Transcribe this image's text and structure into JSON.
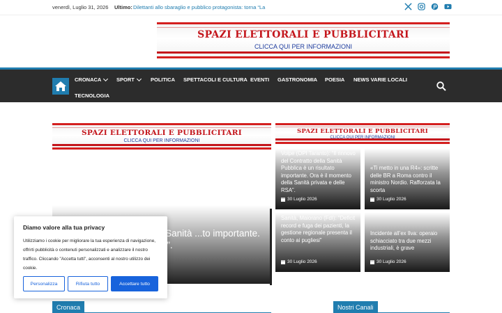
{
  "topbar": {
    "date": "venerdì, Luglio 31, 2026",
    "latest_label": "Ultimo:",
    "latest_text": "Dilettanti allo sbaraglio e pubblico protagonista: torna “La",
    "socials": [
      "x-icon",
      "instagram-icon",
      "pinterest-icon",
      "youtube-icon"
    ]
  },
  "ads": {
    "title": "SPAZI ELETTORALI E PUBBLICITARI",
    "subtitle": "CLICCA QUI PER INFORMAZIONI"
  },
  "nav": {
    "items": [
      {
        "label": "CRONACA",
        "dropdown": true
      },
      {
        "label": "SPORT",
        "dropdown": true
      },
      {
        "label": "POLITICA",
        "dropdown": false
      },
      {
        "label": "SPETTACOLI E CULTURA",
        "dropdown": false
      },
      {
        "label": "EVENTI",
        "dropdown": false
      },
      {
        "label": "GASTRONOMIA",
        "dropdown": false
      },
      {
        "label": "POESIA",
        "dropdown": false
      },
      {
        "label": "NEWS VARIE LOCALI",
        "dropdown": false
      },
      {
        "label": "TECNOLOGIA",
        "dropdown": false
      }
    ]
  },
  "featured": {
    "title": "...ovo del Contratto della Sanità ...to importante. Ora è il ...ata e delle RSA”."
  },
  "cards": [
    {
      "title": "Volpe (OPI Taranto): “Il rinnovo del Contratto della Sanità Pubblica è un risultato importante. Ora è il momento della Sanità privata e delle RSA”.",
      "date": "30 Luglio 2026"
    },
    {
      "title": "«Ti metto in una R4»: scritte delle BR a Roma contro il ministro Nordio. Rafforzata la scorta",
      "date": "30 Luglio 2026"
    },
    {
      "title": "Sanità, Maiorano (FdI): “Deficit record e fuga dei pazienti, la gestione regionale presenta il conto ai pugliesi”",
      "date": "30 Luglio 2026"
    },
    {
      "title": "Incidente all’ex Ilva: operaio schiacciato tra due mezzi industriali, è grave",
      "date": "30 Luglio 2026"
    }
  ],
  "cookie": {
    "title": "Diamo valore alla tua privacy",
    "text": "Utilizziamo i cookie per migliorare la tua esperienza di navigazione, offrirti pubblicità o contenuti personalizzati e analizzare il nostro traffico. Cliccando \"Accetta tutti\", acconsenti al nostro utilizzo dei cookie.",
    "customize": "Personalizza",
    "reject": "Rifiuta tutto",
    "accept": "Accettare tutto"
  },
  "sections": {
    "left": "Cronaca",
    "right": "Nostri Canali"
  },
  "colors": {
    "accent": "#207daf",
    "nav_bg": "#2c2c2c",
    "ad_red": "#c4161c",
    "ad_blue": "#1d3c9e",
    "cookie_blue": "#1863dc"
  }
}
